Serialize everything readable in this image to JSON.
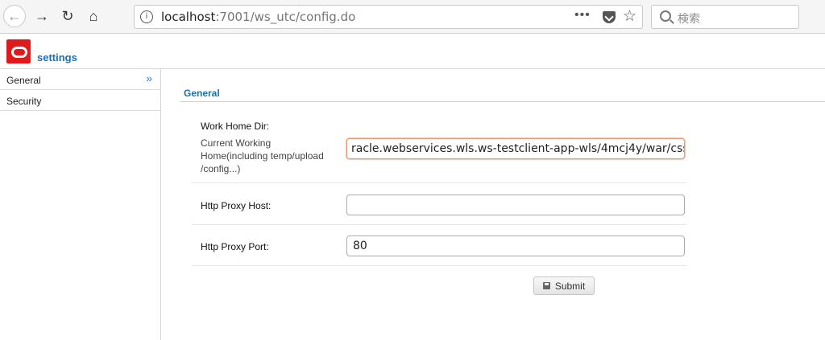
{
  "browser": {
    "url_host": "localhost",
    "url_path": ":7001/ws_utc/config.do",
    "search_placeholder": "検索",
    "icons": [
      "back-icon",
      "forward-icon",
      "reload-icon",
      "home-icon",
      "info-icon",
      "page-actions-icon",
      "pocket-icon",
      "bookmark-star-icon",
      "search-icon"
    ]
  },
  "app": {
    "title": "settings",
    "accent_color": "#1b6fb3",
    "logo_color": "#e01a1a"
  },
  "sidebar": {
    "items": [
      {
        "label": "General",
        "active": true
      },
      {
        "label": "Security",
        "active": false
      }
    ]
  },
  "main": {
    "section_title": "General",
    "work_home": {
      "label": "Work Home Dir:",
      "description": "Current Working Home(including temp/upload /config...)",
      "value": "racle.webservices.wls.ws-testclient-app-wls/4mcj4y/war/css"
    },
    "proxy_host": {
      "label": "Http Proxy Host:",
      "value": ""
    },
    "proxy_port": {
      "label": "Http Proxy Port:",
      "value": "80"
    },
    "submit_label": "Submit"
  }
}
